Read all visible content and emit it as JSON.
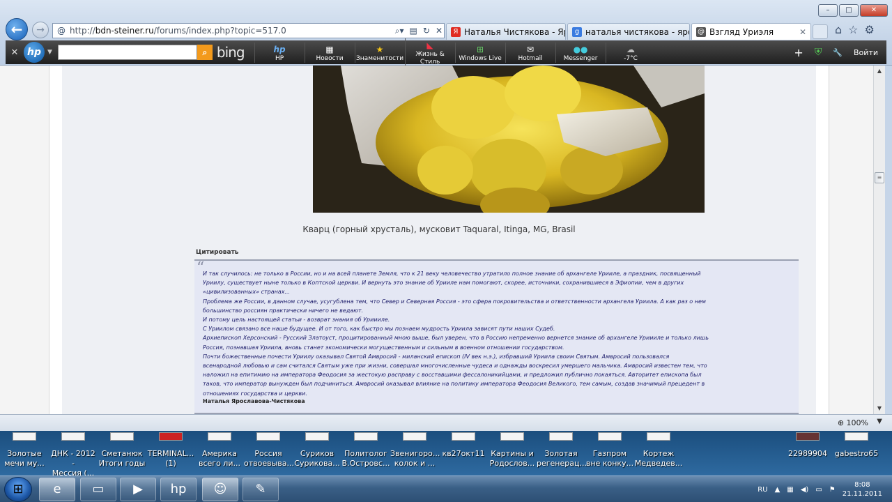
{
  "browser": {
    "url_prefix": "http://",
    "url_host": "bdn-steiner.ru",
    "url_path": "/forums/index.php?topic=517.0",
    "tabs": [
      {
        "label": "Наталья Чистякова - Ярос...",
        "icon": "yandex-icon",
        "color": "#e02c22"
      },
      {
        "label": "наталья чистякова - яросл...",
        "icon": "google-icon",
        "color": "#3a7be0"
      },
      {
        "label": "Взгляд Уриэля",
        "icon": "swirl-icon",
        "color": "#555555"
      }
    ],
    "window_buttons": {
      "minimize": "–",
      "maximize": "□",
      "close": "✕"
    }
  },
  "toolbar": {
    "search_brand": "bing",
    "items": [
      {
        "label": "HP",
        "glyph": "hp"
      },
      {
        "label": "Новости",
        "glyph": "▦"
      },
      {
        "label": "Знаменитости",
        "glyph": "★"
      },
      {
        "label": "Жизнь & Стиль",
        "glyph": "👠"
      },
      {
        "label": "Windows Live",
        "glyph": "⊞"
      },
      {
        "label": "Hotmail",
        "glyph": "✉"
      },
      {
        "label": "Messenger",
        "glyph": "👥"
      },
      {
        "label": "-7°C",
        "glyph": "☁"
      }
    ],
    "add": "+",
    "signin": "Войти"
  },
  "content": {
    "caption": "Кварц (горный хрусталь), мусковит Taquaral, Itinga, MG, Brasil",
    "quote_label": "Цитировать",
    "quote_lines": [
      "И так случилось: не только в России, но и на всей планете Земля, что к 21 веку человечество утратило полное знание об архангеле Урииле, а праздник, посвященный",
      "Уриилу, существует ныне только в Коптской церкви. И вернуть это знание об Урииле нам помогают, скорее, источники, сохранившиеся в Эфиопии, чем в других",
      "«цивилизованных» странах...",
      "Проблема же России, в данном случае, усугублена тем, что Север и Северная Россия - это сфера покровительства и ответственности архангела Уриила. А как раз о нем",
      "большинство россиян практически ничего не ведают.",
      "И потому цель настоящей статьи - возврат знания об Уриииле.",
      "С Уриилом связано все наше будущее. И от того, как быстро мы познаем мудрость Уриила зависят пути наших Судеб.",
      "Архиепископ Херсонский - Русский Златоуст, процитированный мною выше, был уверен, что в Россию непременно вернется знание об архангеле Уриииле и только лишь",
      "Россия, познавшая Уриила, вновь станет экономически могущественным и сильным в военном отношении государством.",
      "Почти божественные почести Уриилу оказывал Святой Амвросий - миланский епископ (IV век н.э.), избравший Уриила своим Святым. Амвросий пользовался",
      "всенародной любовью и сам считался Святым уже при жизни, совершал многочисленные чудеса и однажды воскресил умершего мальчика. Амвросий известен тем, что",
      "наложил на епитимию на императора Феодосия за жестокую расправу с восставшими фессалоникийцами, и предложил публично покаяться. Авторитет епископа был",
      "таков, что император вынужден был подчиниться. Амвросий оказывал влияние на политику императора Феодосия Великого, тем самым, создав значимый прецедент в",
      "отношениях государства и церкви."
    ],
    "quote_author": "Наталья Ярославова-Чистякова"
  },
  "status": {
    "zoom": "100%"
  },
  "desktop_icons": [
    {
      "line1": "Золотые",
      "line2": "мечи   му..."
    },
    {
      "line1": "ДНК - 2012 -",
      "line2": "Мессия (..."
    },
    {
      "line1": "Сметанюк",
      "line2": "Итоги годы"
    },
    {
      "line1": "TERMINAL...",
      "line2": "(1)"
    },
    {
      "line1": "Америка",
      "line2": "всего ли..."
    },
    {
      "line1": "Россия",
      "line2": "отвоевыва..."
    },
    {
      "line1": "Суриков",
      "line2": "Сурикова..."
    },
    {
      "line1": "Политолог",
      "line2": "В.Островс..."
    },
    {
      "line1": "Звенигоро...",
      "line2": "колок  и ..."
    },
    {
      "line1": "кв27окт11",
      "line2": ""
    },
    {
      "line1": "Картины и",
      "line2": "Родослов..."
    },
    {
      "line1": "Золотая",
      "line2": "регенерац..."
    },
    {
      "line1": "Газпром",
      "line2": "вне конку..."
    },
    {
      "line1": "Кортеж",
      "line2": "Медведев..."
    },
    {
      "line1": "22989904",
      "line2": ""
    },
    {
      "line1": "gabestro65",
      "line2": ""
    }
  ],
  "taskbar": {
    "apps": [
      "ie-icon",
      "folder-icon",
      "media-player-icon",
      "hp-icon",
      "people-icon",
      "paint-icon"
    ],
    "lang": "RU",
    "time": "8:08",
    "date": "21.11.2011"
  }
}
